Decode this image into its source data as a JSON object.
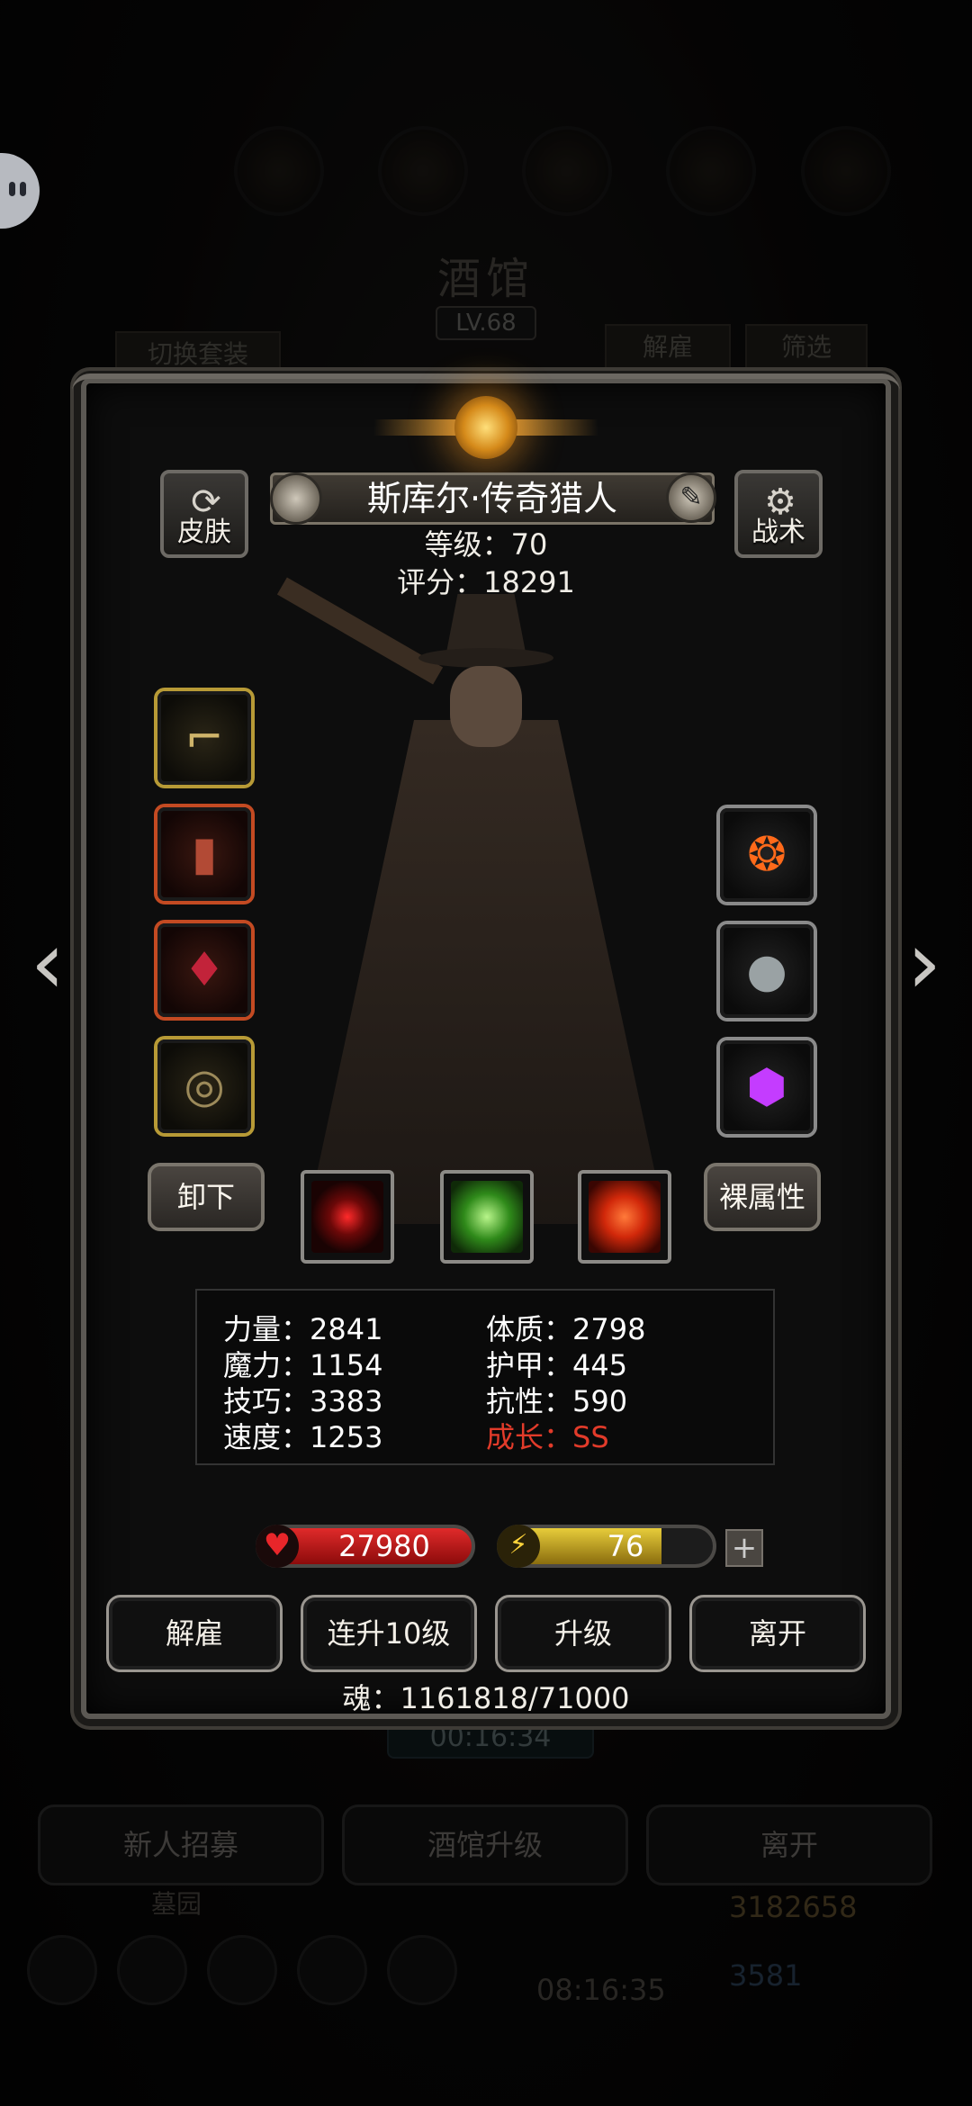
{
  "background": {
    "title": "酒馆",
    "level": "LV.68",
    "switch_outfit": "切换套装",
    "dismiss": "解雇",
    "filter": "筛选",
    "timer": "00:16:34",
    "recruit": "新人招募",
    "tavern_upgrade": "酒馆升级",
    "leave": "离开",
    "cemetery": "墓园",
    "gold": "3182658",
    "gems": "3581",
    "chest_timer": "08:16:35"
  },
  "hero": {
    "name": "斯库尔·传奇猎人",
    "level_line": "等级：70",
    "score_line": "评分：18291"
  },
  "buttons": {
    "skin": "皮肤",
    "tactics": "战术",
    "unequip": "卸下",
    "naked_attr": "裸属性"
  },
  "stats": {
    "strength": "力量：2841",
    "magic": "魔力：1154",
    "skill": "技巧：3383",
    "speed": "速度：1253",
    "constitution": "体质：2798",
    "armor": "护甲：445",
    "resistance": "抗性：590",
    "growth": "成长：SS"
  },
  "bars": {
    "hp": "27980",
    "energy": "76",
    "energy_fraction": 0.76,
    "plus": "+"
  },
  "actions": {
    "dismiss": "解雇",
    "level_up_10": "连升10级",
    "level_up": "升级",
    "leave": "离开"
  },
  "soul": "魂：1161818/71000",
  "nav": {
    "prev": "‹",
    "next": "›"
  },
  "colors": {
    "growth": "#e23b2a",
    "hp": "#e02a2a",
    "energy": "#e7cc3a"
  }
}
